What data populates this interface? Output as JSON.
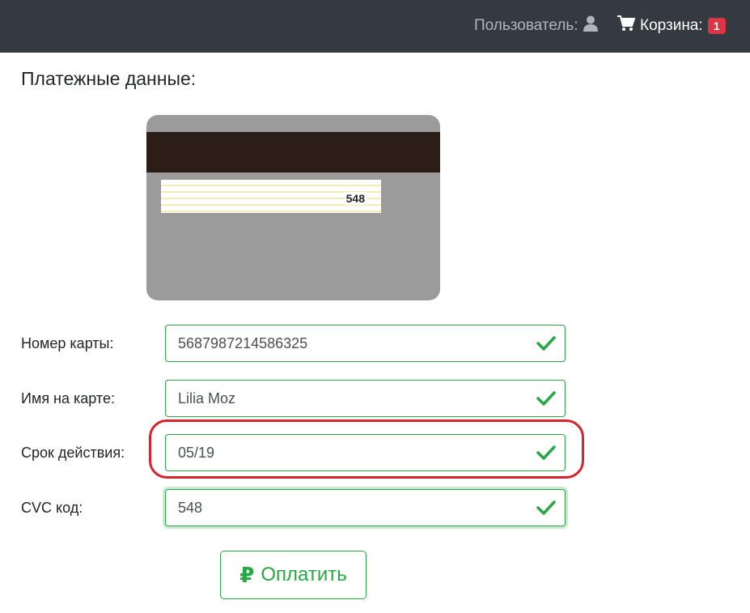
{
  "navbar": {
    "user_label": "Пользователь:",
    "user_icon": "user-icon",
    "cart_icon": "shopping-cart-icon",
    "cart_label": "Корзина:",
    "cart_count": "1"
  },
  "page": {
    "title": "Платежные данные:"
  },
  "card_preview": {
    "cvc": "548"
  },
  "form": {
    "card_number": {
      "label": "Номер карты:",
      "value": "5687987214586325"
    },
    "card_name": {
      "label": "Имя на карте:",
      "value": "Lilia Moz"
    },
    "expiry": {
      "label": "Срок действия:",
      "value": "05/19"
    },
    "cvc": {
      "label": "CVC код:",
      "value": "548"
    }
  },
  "actions": {
    "pay_icon": "₽",
    "pay_label": "Оплатить"
  },
  "colors": {
    "navbar": "#343a40",
    "valid": "#28a745",
    "badge": "#dc3545",
    "annotation": "#d7232e"
  }
}
